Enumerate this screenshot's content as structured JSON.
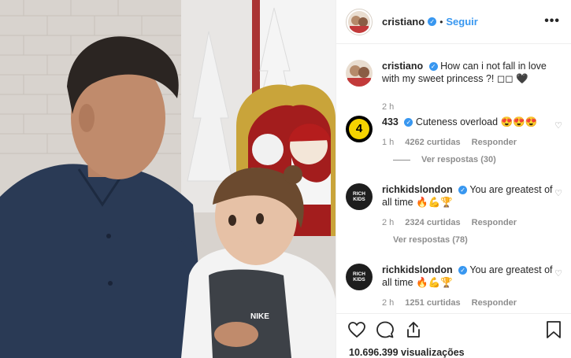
{
  "header": {
    "username": "cristiano",
    "follow_label": "Seguir",
    "dot": "•",
    "more": "•••"
  },
  "caption": {
    "username": "cristiano",
    "text": "How can i not fall in love with my sweet princess ?! ◻◻ 🖤",
    "time": "2 h"
  },
  "comments": [
    {
      "username": "433",
      "text": "Cuteness overload 😍😍😍",
      "time": "1 h",
      "likes": "4262 curtidas",
      "reply": "Responder",
      "view_replies": "Ver respostas (30)",
      "avatar_label": "4"
    },
    {
      "username": "richkidslondon",
      "text": "You are greatest of all time 🔥💪🏆",
      "time": "2 h",
      "likes": "2324 curtidas",
      "reply": "Responder",
      "view_replies": "Ver respostas (78)",
      "avatar_label": "RICH KIDS"
    },
    {
      "username": "richkidslondon",
      "text": "You are greatest of all time 🔥💪🏆",
      "time": "2 h",
      "likes": "1251 curtidas",
      "reply": "Responder",
      "avatar_label": "RICH KIDS"
    }
  ],
  "footer": {
    "views": "10.696.399 visualizações"
  },
  "media": {
    "shirt_logo": "NIKE"
  },
  "colors": {
    "link": "#3897f0",
    "muted": "#8e8e8e",
    "text": "#262626",
    "badge_yellow": "#f5d300"
  },
  "icons": [
    "heart-icon",
    "comment-icon",
    "share-icon",
    "bookmark-icon",
    "verified-icon",
    "more-icon"
  ]
}
